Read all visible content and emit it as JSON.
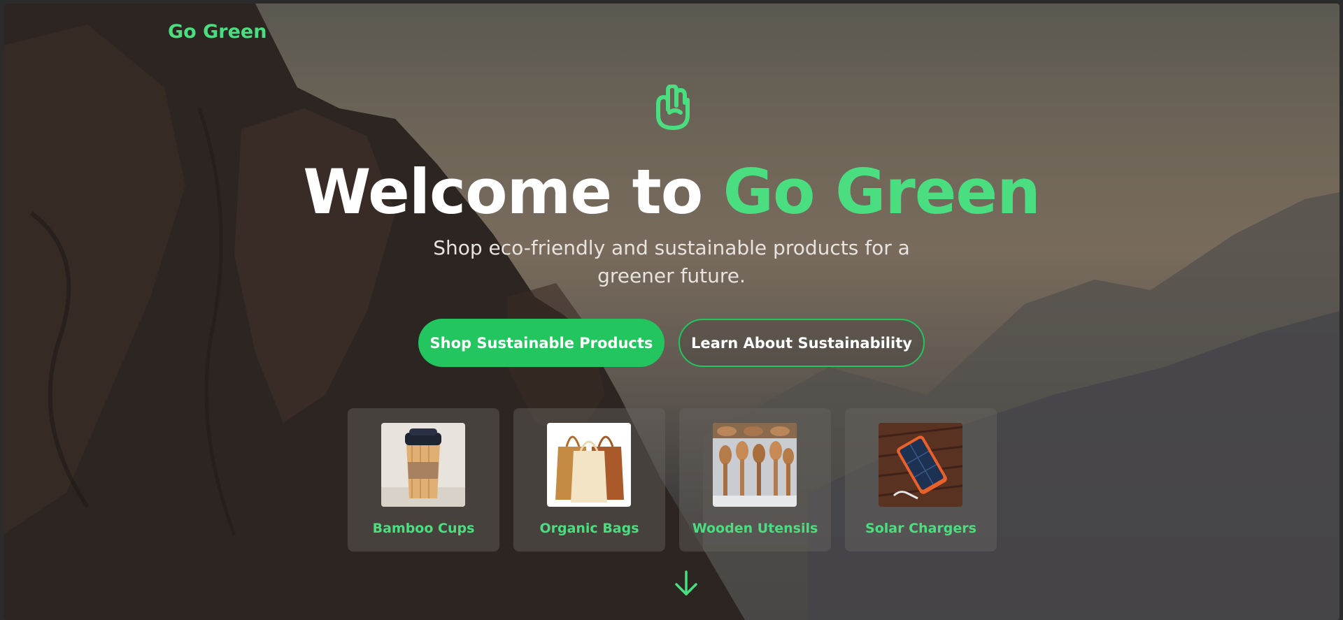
{
  "brand": {
    "name": "Go Green"
  },
  "hero": {
    "icon": "raised-hand-icon",
    "title_prefix": "Welcome to ",
    "title_accent": "Go Green",
    "subtitle": "Shop eco-friendly and sustainable products for a greener future.",
    "primary_button": "Shop Sustainable Products",
    "secondary_button": "Learn About Sustainability"
  },
  "categories": [
    {
      "label": "Bamboo Cups",
      "image": "bamboo-cup-photo"
    },
    {
      "label": "Organic Bags",
      "image": "tote-bags-photo"
    },
    {
      "label": "Wooden Utensils",
      "image": "wooden-utensils-photo"
    },
    {
      "label": "Solar Chargers",
      "image": "solar-charger-photo"
    }
  ],
  "scroll_hint": {
    "icon": "arrow-down-icon"
  },
  "colors": {
    "accent": "#4ade80",
    "button": "#22c55e",
    "text": "#ffffff",
    "subtitle": "#e7e3de"
  }
}
